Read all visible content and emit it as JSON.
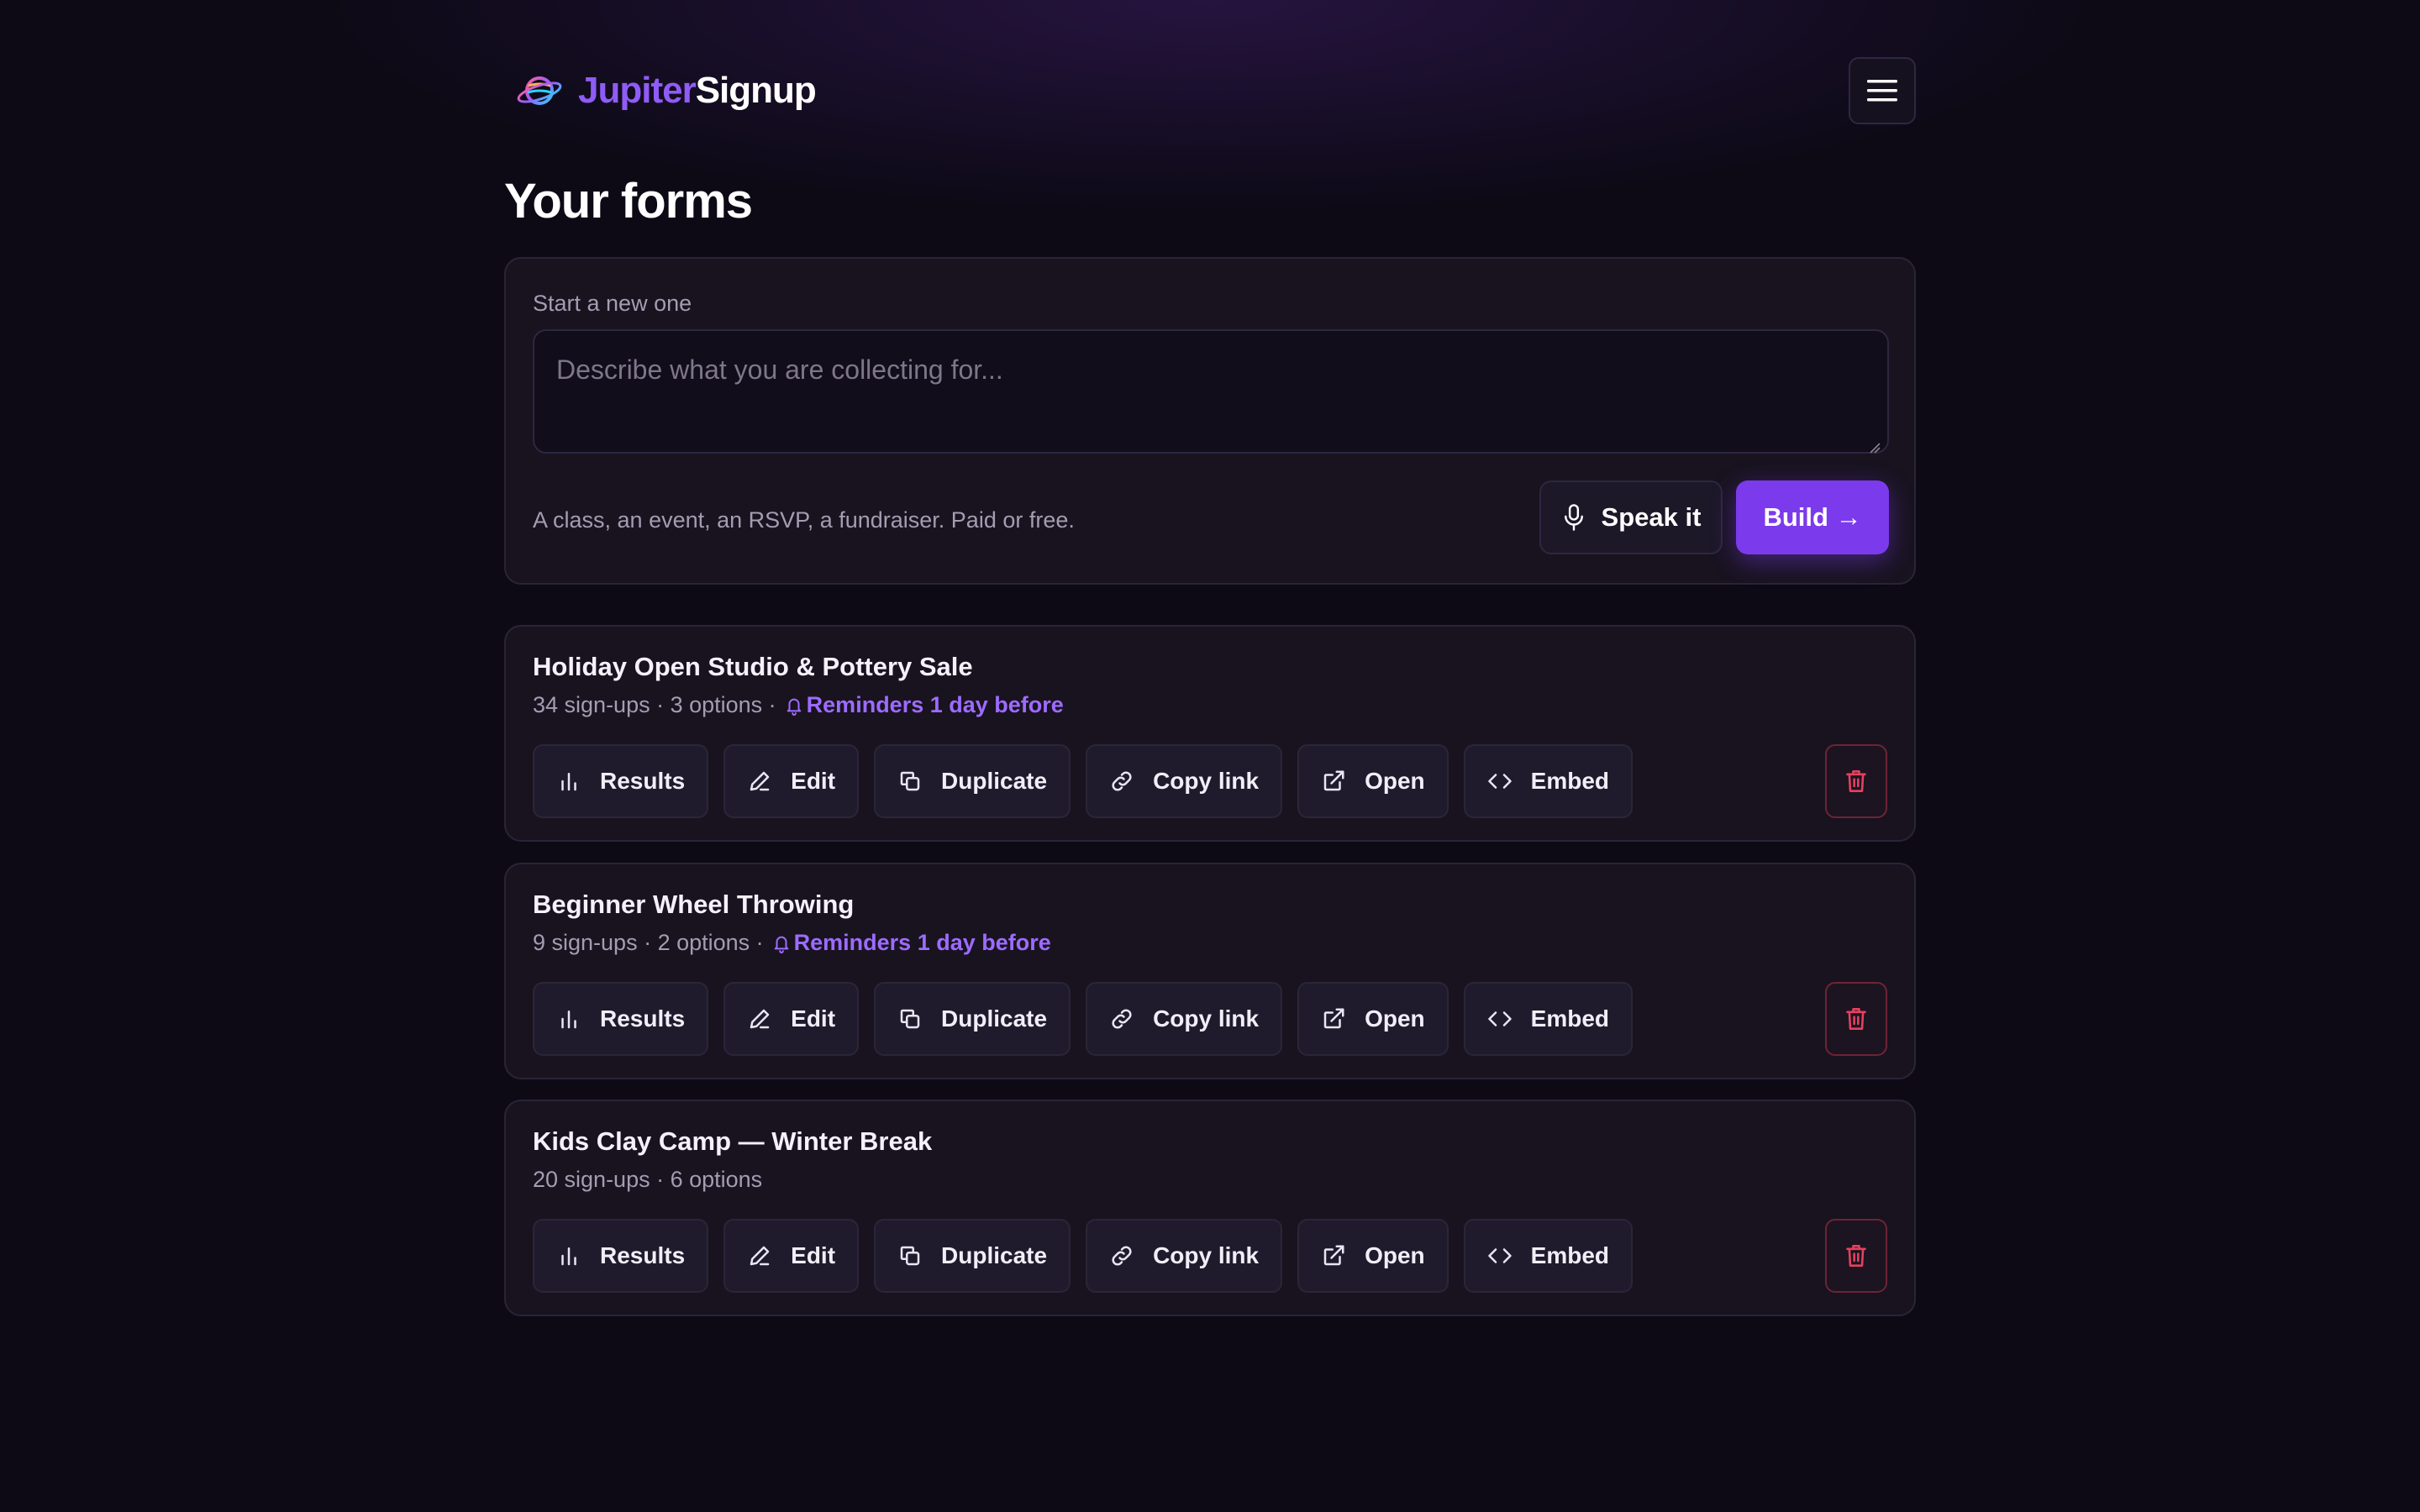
{
  "brand": {
    "name_part1": "Jupiter",
    "name_part2": "Signup",
    "logo_icon": "planet-icon"
  },
  "header": {
    "menu_icon": "hamburger-menu-icon"
  },
  "page_title": "Your forms",
  "new_form": {
    "label": "Start a new one",
    "placeholder": "Describe what you are collecting for...",
    "value": "",
    "hint": "A class, an event, an RSVP, a fundraiser. Paid or free.",
    "speak_label": "Speak it",
    "build_label": "Build →"
  },
  "actions": {
    "results": "Results",
    "edit": "Edit",
    "duplicate": "Duplicate",
    "copy_link": "Copy link",
    "open": "Open",
    "embed": "Embed"
  },
  "forms": [
    {
      "title": "Holiday Open Studio & Pottery Sale",
      "meta": "34 sign-ups · 3 options ·",
      "reminder": "Reminders 1 day before"
    },
    {
      "title": "Beginner Wheel Throwing",
      "meta": "9 sign-ups · 2 options ·",
      "reminder": "Reminders 1 day before"
    },
    {
      "title": "Kids Clay Camp — Winter Break",
      "meta": "20 sign-ups · 6 options",
      "reminder": ""
    }
  ],
  "colors": {
    "background": "#0d0a16",
    "card": "#18131f",
    "accent": "#7c3aed",
    "accent_text": "#9d6bff",
    "delete": "#e5415f"
  }
}
